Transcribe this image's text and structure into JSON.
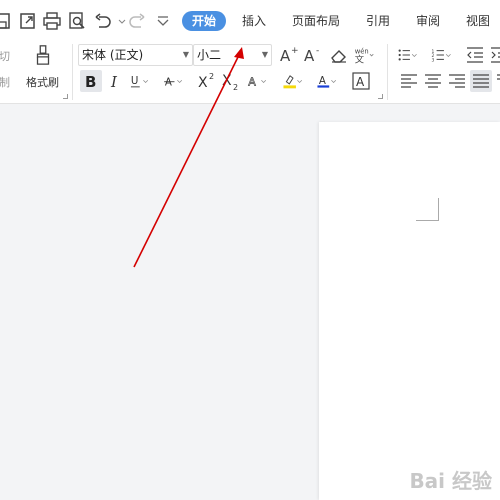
{
  "tabs": [
    {
      "label": "开始",
      "active": true
    },
    {
      "label": "插入"
    },
    {
      "label": "页面布局"
    },
    {
      "label": "引用"
    },
    {
      "label": "审阅"
    },
    {
      "label": "视图"
    }
  ],
  "quick_access_icons": [
    "save-icon",
    "export-icon",
    "print-icon",
    "print-preview-icon",
    "undo-icon",
    "redo-icon",
    "customize-icon"
  ],
  "clipboard": {
    "cut_label": "剪切",
    "copy_label": "复制",
    "format_painter_label": "格式刷"
  },
  "font": {
    "family": "宋体 (正文)",
    "size": "小二"
  },
  "format_buttons": {
    "bold": "B",
    "italic": "I",
    "underline": "U",
    "clear": "A",
    "wen": "wén"
  },
  "colors": {
    "accent": "#4a90e2",
    "highlight": "#f5d90a",
    "font_color": "#1a3fd6",
    "annotation_arrow": "#d40000"
  },
  "watermark": "Bai 经验"
}
